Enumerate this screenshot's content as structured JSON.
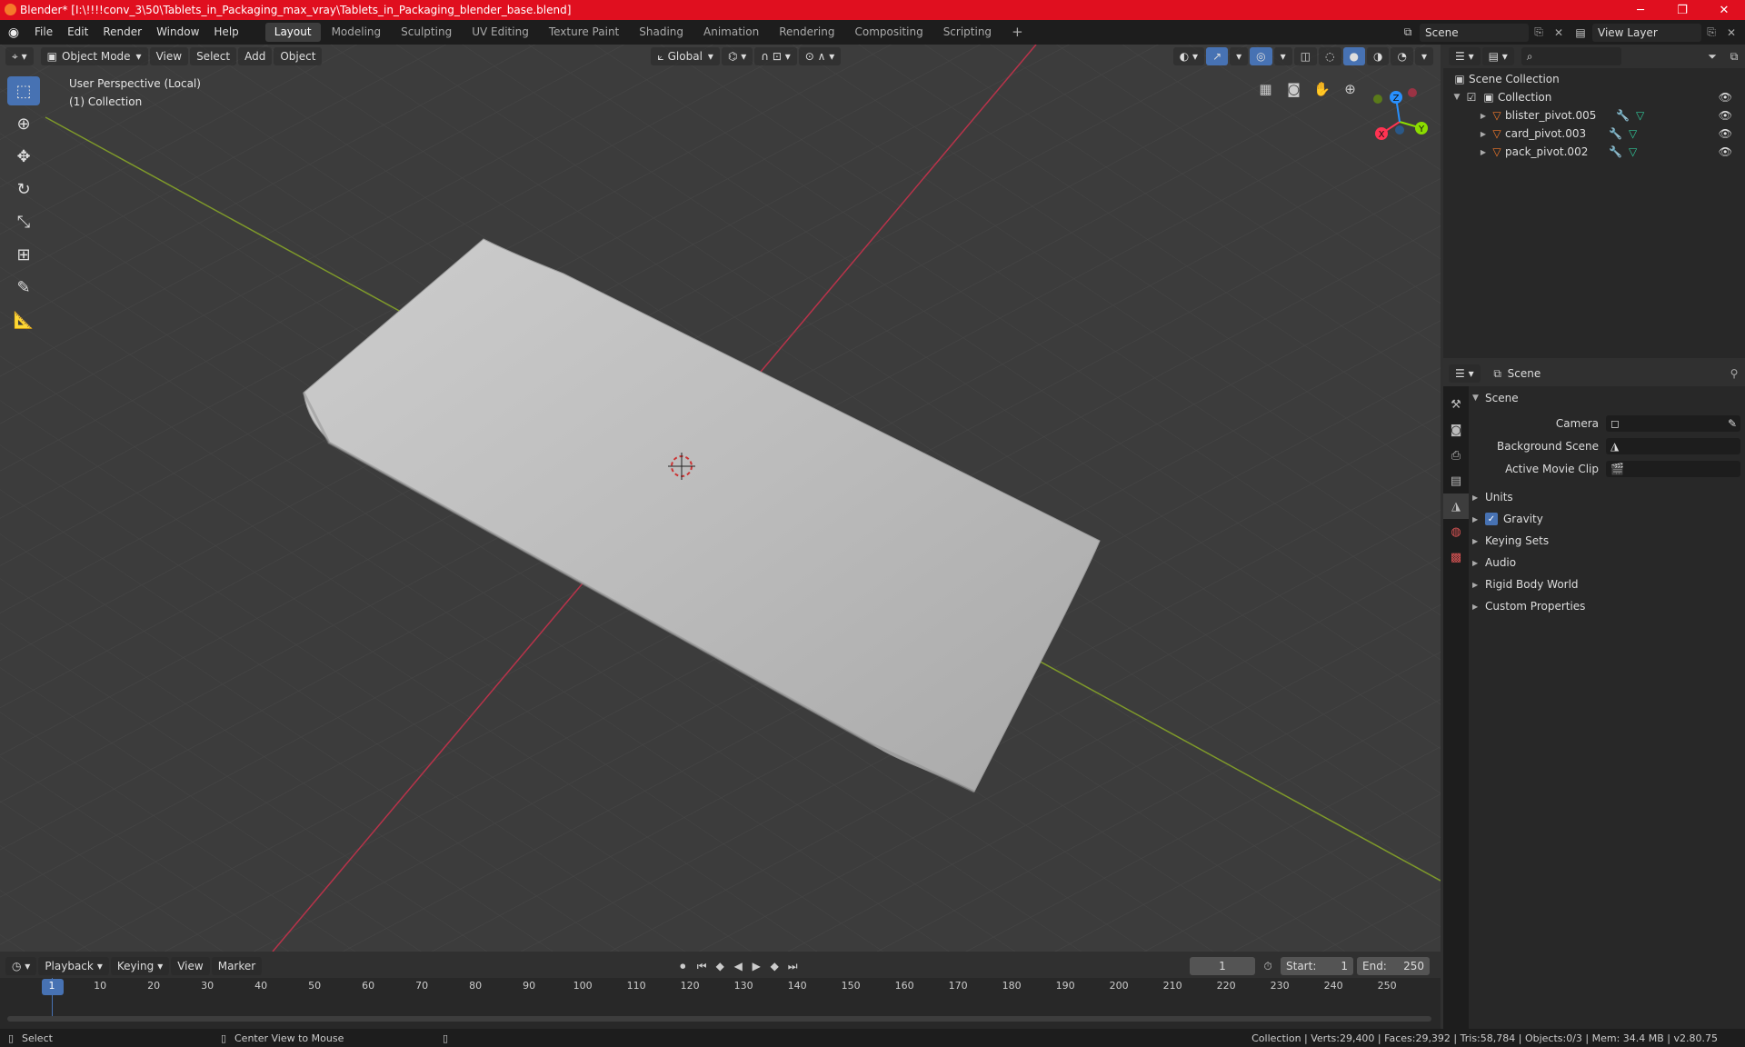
{
  "titlebar": {
    "title": "Blender* [I:\\!!!!conv_3\\50\\Tablets_in_Packaging_max_vray\\Tablets_in_Packaging_blender_base.blend]",
    "minimize": "─",
    "maximize": "❐",
    "close": "✕"
  },
  "menubar": {
    "menus": [
      "File",
      "Edit",
      "Render",
      "Window",
      "Help"
    ],
    "workspaces": [
      "Layout",
      "Modeling",
      "Sculpting",
      "UV Editing",
      "Texture Paint",
      "Shading",
      "Animation",
      "Rendering",
      "Compositing",
      "Scripting"
    ],
    "add_tab": "+",
    "scene_name": "Scene",
    "view_layer": "View Layer"
  },
  "viewport": {
    "mode": "Object Mode",
    "menus": [
      "View",
      "Select",
      "Add",
      "Object"
    ],
    "orientation": "Global",
    "perspective_label": "User Perspective (Local)",
    "collection_label": "(1) Collection",
    "gizmo": {
      "x": "X",
      "y": "Y",
      "z": "Z"
    }
  },
  "outliner": {
    "root": "Scene Collection",
    "collection": "Collection",
    "objects": [
      "blister_pivot.005",
      "card_pivot.003",
      "pack_pivot.002"
    ]
  },
  "properties": {
    "header_title": "Scene",
    "panel_title": "Scene",
    "fields": [
      {
        "label": "Camera",
        "value": ""
      },
      {
        "label": "Background Scene",
        "value": ""
      },
      {
        "label": "Active Movie Clip",
        "value": ""
      }
    ],
    "sections": [
      "Units",
      "Gravity",
      "Keying Sets",
      "Audio",
      "Rigid Body World",
      "Custom Properties"
    ],
    "gravity_checked": true
  },
  "timeline": {
    "menus": [
      "Playback",
      "Keying",
      "View",
      "Marker"
    ],
    "current_frame": "1",
    "start_label": "Start:",
    "start": "1",
    "end_label": "End:",
    "end": "250",
    "ticks": [
      "1",
      "10",
      "20",
      "30",
      "40",
      "50",
      "60",
      "70",
      "80",
      "90",
      "100",
      "110",
      "120",
      "130",
      "140",
      "150",
      "160",
      "170",
      "180",
      "190",
      "200",
      "210",
      "220",
      "230",
      "240",
      "250"
    ]
  },
  "statusbar": {
    "left_action": "Select",
    "middle_action": "Center View to Mouse",
    "stats": "Collection | Verts:29,400 | Faces:29,392 | Tris:58,784 | Objects:0/3 | Mem: 34.4 MB | v2.80.75"
  },
  "colors": {
    "accent": "#4772b3",
    "title_red": "#e00f1f",
    "x_axis": "#ff3352",
    "y_axis": "#8bdc00",
    "z_axis": "#2890ff"
  }
}
